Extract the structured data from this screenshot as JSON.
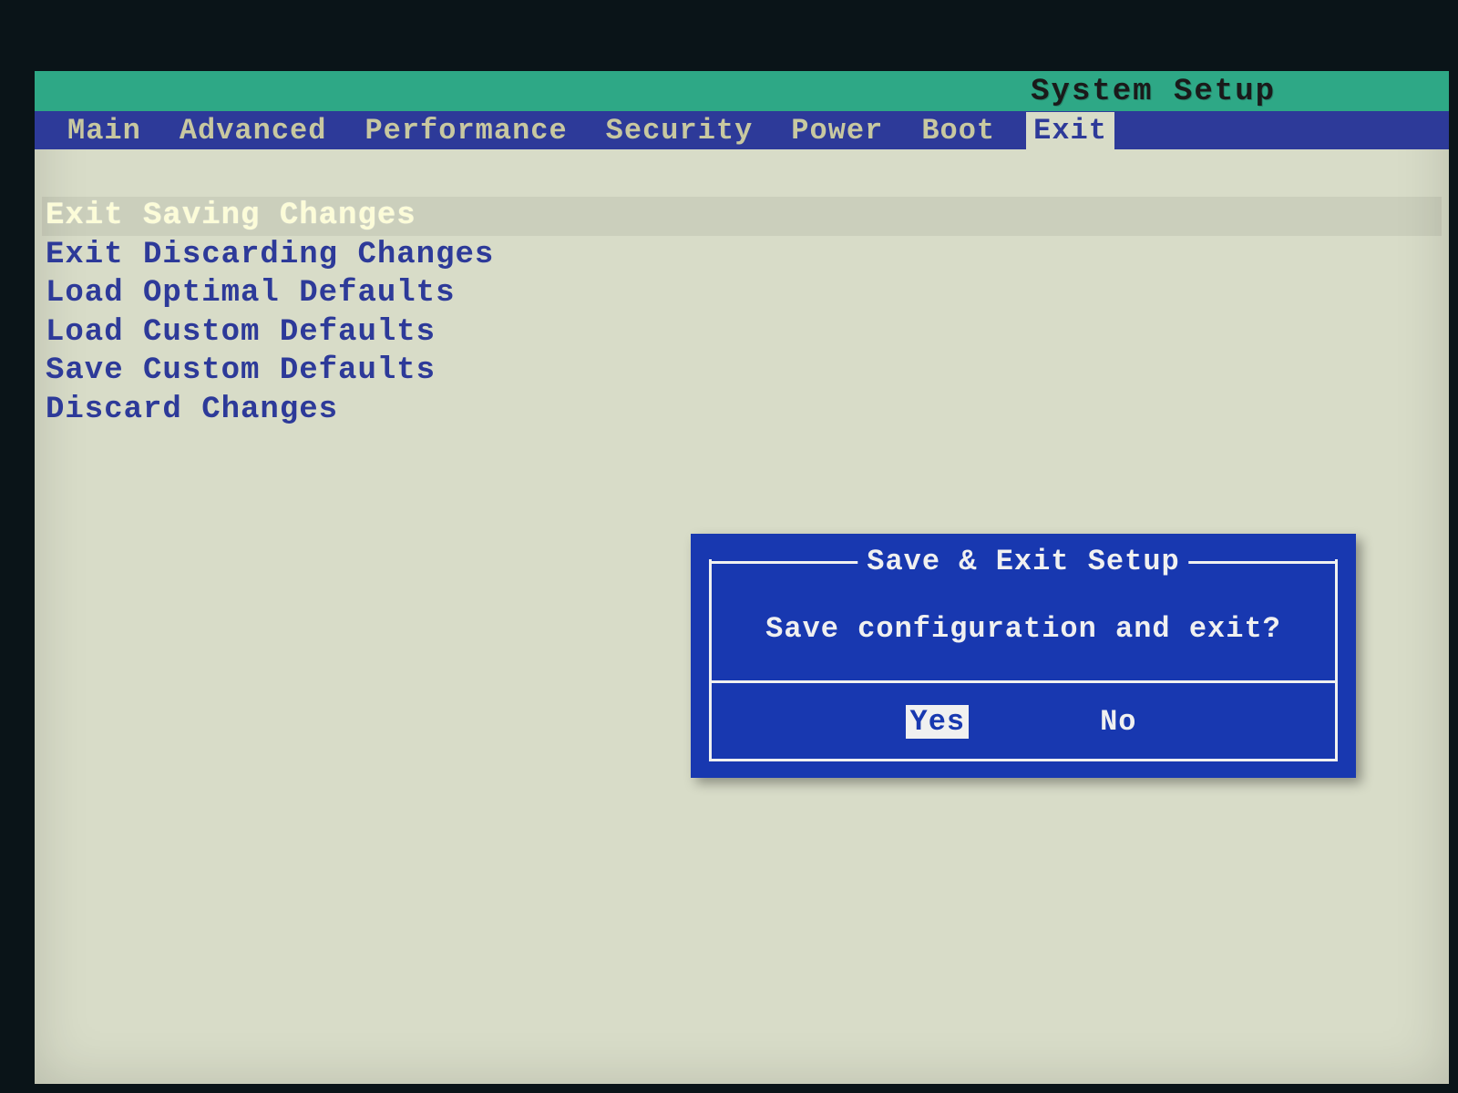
{
  "header": {
    "title": "System Setup"
  },
  "tabs": [
    {
      "label": "Main",
      "active": false
    },
    {
      "label": "Advanced",
      "active": false
    },
    {
      "label": "Performance",
      "active": false
    },
    {
      "label": "Security",
      "active": false
    },
    {
      "label": "Power",
      "active": false
    },
    {
      "label": "Boot",
      "active": false
    },
    {
      "label": "Exit",
      "active": true
    }
  ],
  "exit_menu": {
    "items": [
      {
        "label": "Exit Saving Changes",
        "selected": true
      },
      {
        "label": "Exit Discarding Changes",
        "selected": false
      },
      {
        "label": "Load Optimal Defaults",
        "selected": false
      },
      {
        "label": "Load Custom Defaults",
        "selected": false
      },
      {
        "label": "Save Custom Defaults",
        "selected": false
      },
      {
        "label": "Discard Changes",
        "selected": false
      }
    ]
  },
  "dialog": {
    "title": "Save & Exit Setup",
    "message": "Save configuration and exit?",
    "yes_label": "Yes",
    "no_label": "No",
    "focused": "yes"
  },
  "colors": {
    "teal": "#2ea886",
    "blue_menu": "#2d3a99",
    "dialog_blue": "#1838b0",
    "bg": "#d8dcc8",
    "hilite": "#fcfcd8"
  }
}
